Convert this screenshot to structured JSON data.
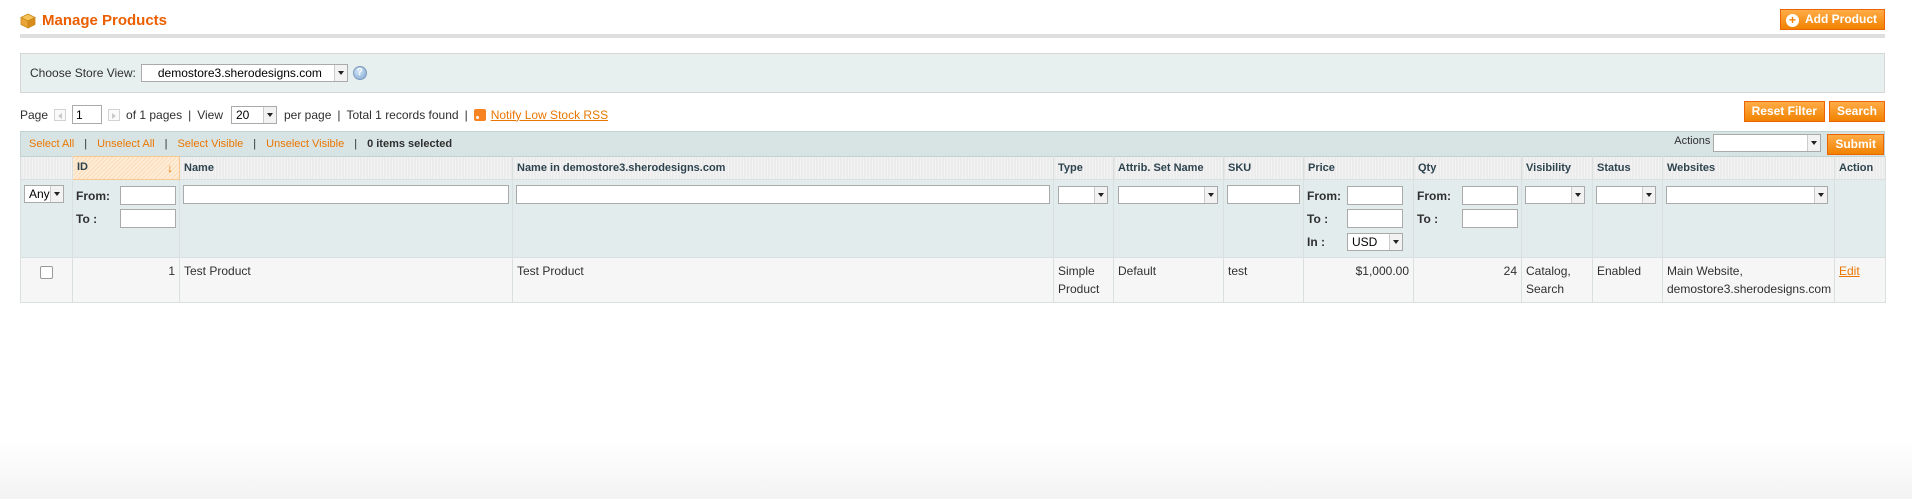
{
  "header": {
    "title": "Manage Products",
    "add_button": "Add Product"
  },
  "store_switcher": {
    "label": "Choose Store View:",
    "selected": "demostore3.sherodesigns.com"
  },
  "pager": {
    "page_label": "Page",
    "page_value": "1",
    "of_pages": "of 1 pages",
    "view_label": "View",
    "per_page_value": "20",
    "per_page_label": "per page",
    "total": "Total 1 records found",
    "rss_link": "Notify Low Stock RSS",
    "reset_button": "Reset Filter",
    "search_button": "Search"
  },
  "massaction": {
    "select_all": "Select All",
    "unselect_all": "Unselect All",
    "select_visible": "Select Visible",
    "unselect_visible": "Unselect Visible",
    "selected_count": "0 items selected",
    "actions_label": "Actions",
    "submit_button": "Submit"
  },
  "columns": [
    "",
    "ID",
    "Name",
    "Name in demostore3.sherodesigns.com",
    "Type",
    "Attrib. Set Name",
    "SKU",
    "Price",
    "Qty",
    "Visibility",
    "Status",
    "Websites",
    "Action"
  ],
  "filters": {
    "any": "Any",
    "from": "From:",
    "to": "To :",
    "in": "In :",
    "currency": "USD"
  },
  "rows": [
    {
      "id": "1",
      "name": "Test Product",
      "store_name": "Test Product",
      "type_1": "Simple",
      "type_2": "Product",
      "attrib_set": "Default",
      "sku": "test",
      "price": "$1,000.00",
      "qty": "24",
      "visibility_1": "Catalog,",
      "visibility_2": "Search",
      "status": "Enabled",
      "websites_1": "Main Website,",
      "websites_2": "demostore3.sherodesigns.com",
      "action": "Edit"
    }
  ],
  "colors": {
    "accent": "#eb5e00",
    "button": "#f18200",
    "link": "#ea7601",
    "filter_bg": "#e3ecec"
  }
}
